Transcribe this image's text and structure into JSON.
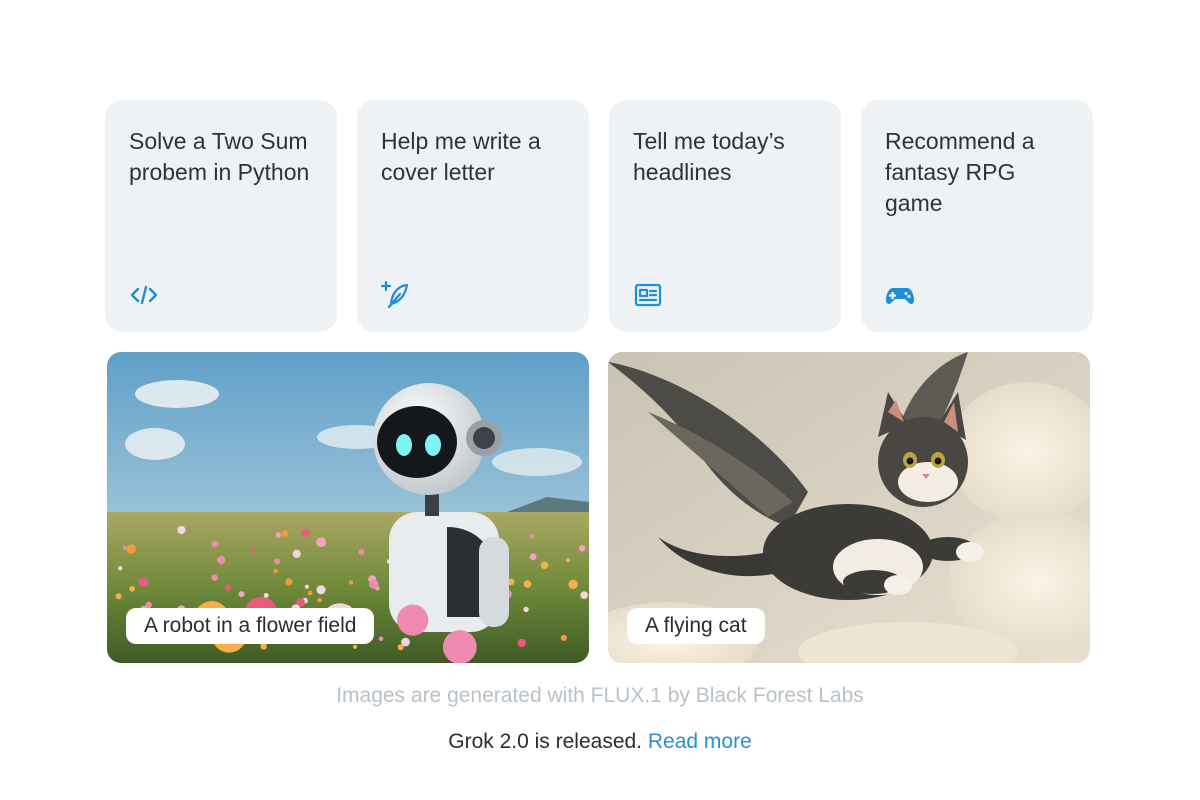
{
  "suggestions": [
    {
      "label": "Solve a Two Sum probem in Python",
      "icon": "code-icon"
    },
    {
      "label": "Help me write a cover letter",
      "icon": "quill-sparkle-icon"
    },
    {
      "label": "Tell me today’s headlines",
      "icon": "newspaper-icon"
    },
    {
      "label": "Recommend a fantasy RPG game",
      "icon": "gamepad-icon"
    }
  ],
  "image_prompts": [
    {
      "caption": "A robot in a flower field"
    },
    {
      "caption": "A flying cat"
    }
  ],
  "footer": {
    "credit": "Images are generated with FLUX.1 by Black Forest Labs",
    "release_text": "Grok 2.0 is released.",
    "read_more": "Read more"
  },
  "colors": {
    "card_bg": "#eef2f5",
    "icon_accent": "#1d8fd8",
    "link": "#2a8fd4",
    "muted_text": "#b9c2c8"
  }
}
